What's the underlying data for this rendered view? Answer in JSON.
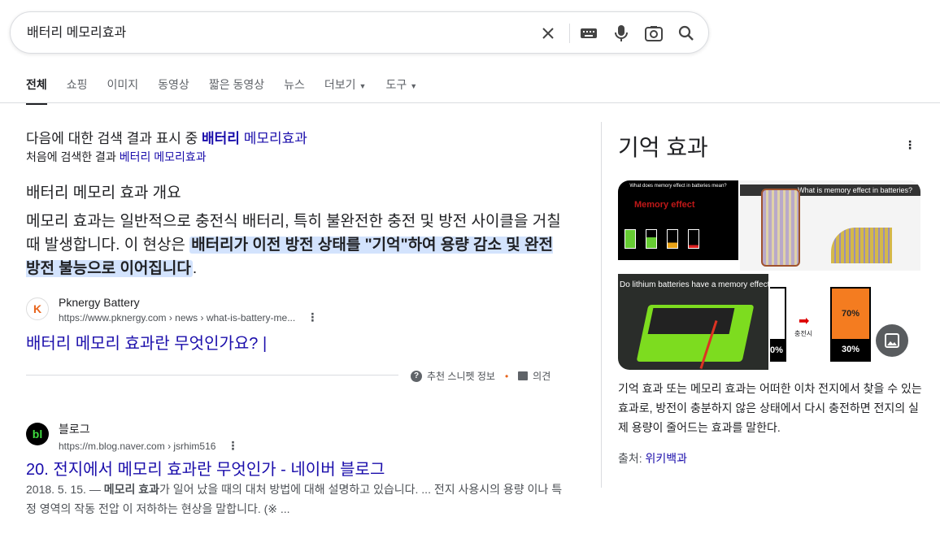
{
  "search": {
    "query": "배터리 메모리효과"
  },
  "tabs": [
    {
      "label": "전체",
      "active": true
    },
    {
      "label": "쇼핑"
    },
    {
      "label": "이미지"
    },
    {
      "label": "동영상"
    },
    {
      "label": "짧은 동영상"
    },
    {
      "label": "뉴스"
    },
    {
      "label": "더보기",
      "dropdown": true
    },
    {
      "label": "도구",
      "dropdown": true
    }
  ],
  "correction": {
    "prefix": "다음에 대한 검색 결과 표시 중",
    "bold_term": "배터리",
    "rest_term": "메모리효과",
    "orig_prefix": "처음에 검색한 결과",
    "orig_link": "베터리 메모리효과"
  },
  "snippet": {
    "heading": "배터리 메모리 효과 개요",
    "text_before": "메모리 효과는 일반적으로 충전식 배터리, 특히 불완전한 충전 및 방전 사이클을 거칠 때 발생합니다. 이 현상은 ",
    "highlight": "배터리가 이전 방전 상태를 \"기억\"하여 용량 감소 및 완전 방전 불능으로 이어집니다",
    "text_after": ".",
    "source_name": "Pknergy Battery",
    "source_url": "https://www.pknergy.com › news › what-is-battery-me...",
    "title": "배터리 메모리 효과란 무엇인가요? |",
    "about": "추천 스니펫 정보",
    "feedback": "의견"
  },
  "result2": {
    "source_name": "블로그",
    "source_url": "https://m.blog.naver.com › jsrhim516",
    "title": "20. 전지에서 메모리 효과란 무엇인가 - 네이버 블로그",
    "date": "2018. 5. 15. — ",
    "bold": "메모리 효과",
    "desc": "가 일어 났을 때의 대처 방법에 대해 설명하고 있습니다. ... 전지 사용시의 용량 이나 특정 영역의 작동 전압 이 저하하는 현상을 말합니다. (※ ..."
  },
  "knowledge_panel": {
    "title": "기억 효과",
    "images": {
      "img1_caption": "What does memory effect in batteries mean?",
      "img1_text": "Memory effect",
      "img2_caption": "What is memory effect in batteries?",
      "img3_caption": "Do lithium batteries have a memory effect?",
      "img4_pct_top": "70%",
      "img4_pct_bottom": "30%",
      "img4_pct_left": "0%",
      "img4_label": "충전시"
    },
    "description": "기억 효과 또는 메모리 효과는 어떠한 이차 전지에서 찾을 수 있는 효과로, 방전이 충분하지 않은 상태에서 다시 충전하면 전지의 실제 용량이 줄어드는 효과를 말한다.",
    "source_label": "출처: ",
    "source_link": "위키백과"
  }
}
